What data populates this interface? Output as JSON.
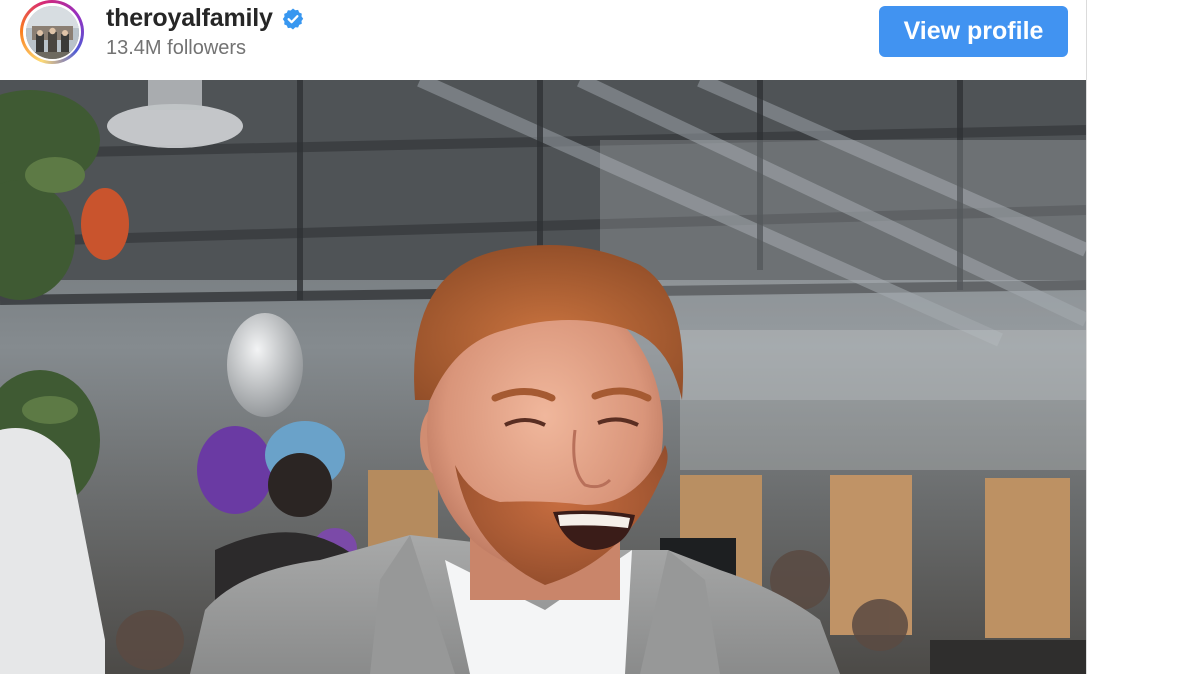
{
  "header": {
    "username": "theroyalfamily",
    "followers": "13.4M followers",
    "view_profile_label": "View profile"
  },
  "icons": {
    "verified": "verified-badge-icon",
    "avatar": "profile-avatar"
  },
  "colors": {
    "button_bg": "#4193f1",
    "verified_blue": "#3897f0",
    "username": "#262626",
    "followers": "#737373"
  }
}
